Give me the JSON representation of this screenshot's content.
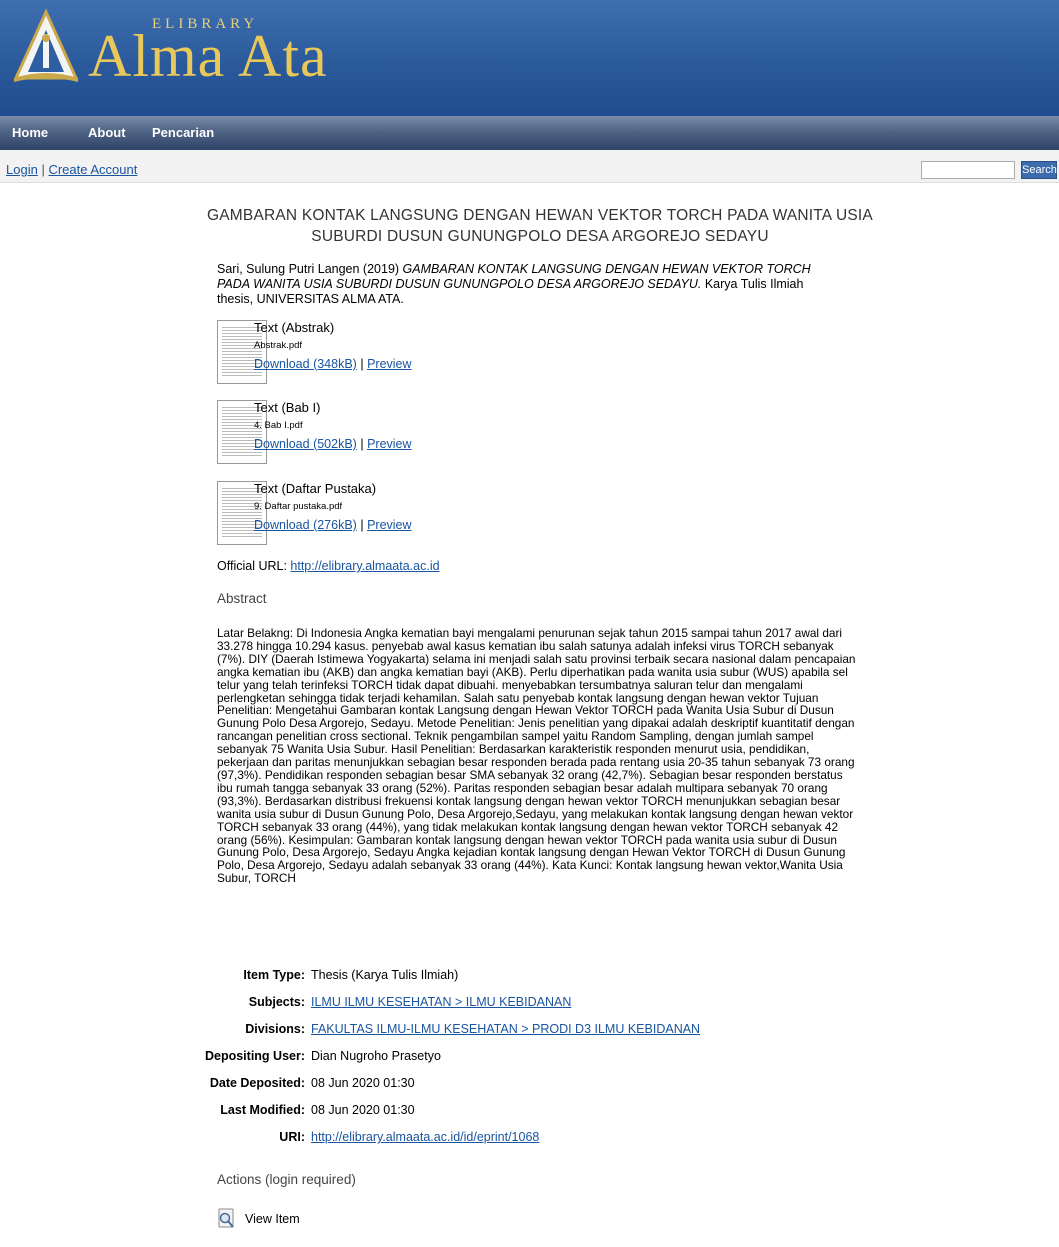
{
  "header": {
    "logo_small": "ELIBRARY",
    "logo_main": "Alma Ata"
  },
  "nav": [
    "Home",
    "About",
    "Pencarian"
  ],
  "account": {
    "login": "Login",
    "separator": "|",
    "create": "Create Account"
  },
  "search": {
    "button": "Search",
    "value": ""
  },
  "title": "GAMBARAN KONTAK LANGSUNG DENGAN HEWAN VEKTOR TORCH PADA WANITA USIA SUBURDI DUSUN GUNUNGPOLO DESA ARGOREJO SEDAYU",
  "citation": {
    "author_year": "Sari, Sulung Putri Langen (2019) ",
    "title_italic": "GAMBARAN KONTAK LANGSUNG DENGAN HEWAN VEKTOR TORCH PADA WANITA USIA SUBURDI DUSUN GUNUNGPOLO DESA ARGOREJO SEDAYU.",
    "rest": " Karya Tulis Ilmiah thesis, UNIVERSITAS ALMA ATA."
  },
  "documents": [
    {
      "type": "Text (Abstrak)",
      "file": "Abstrak.pdf",
      "download": "Download (348kB)",
      "sep": "|",
      "preview": "Preview"
    },
    {
      "type": "Text (Bab I)",
      "file": "4. Bab I.pdf",
      "download": "Download (502kB)",
      "sep": "|",
      "preview": "Preview"
    },
    {
      "type": "Text (Daftar Pustaka)",
      "file": "9. Daftar pustaka.pdf",
      "download": "Download (276kB)",
      "sep": "|",
      "preview": "Preview"
    }
  ],
  "official": {
    "label": "Official URL: ",
    "url": "http://elibrary.almaata.ac.id"
  },
  "abstract_heading": "Abstract",
  "abstract": "Latar Belakng: Di Indonesia Angka kematian bayi mengalami penurunan sejak tahun 2015 sampai tahun 2017 awal dari 33.278 hingga 10.294 kasus. penyebab awal kasus kematian ibu salah satunya adalah infeksi virus TORCH sebanyak (7%). DIY (Daerah Istimewa Yogyakarta) selama ini menjadi salah satu provinsi terbaik secara nasional dalam pencapaian angka kematian ibu (AKB) dan angka kematian bayi (AKB). Perlu diperhatikan pada wanita usia subur (WUS) apabila sel telur yang telah terinfeksi TORCH tidak dapat dibuahi. menyebabkan tersumbatnya saluran telur dan mengalami perlengketan sehingga tidak terjadi kehamilan. Salah satu penyebab kontak langsung dengan hewan vektor  Tujuan Penelitian: Mengetahui Gambaran kontak Langsung dengan Hewan Vektor TORCH pada Wanita Usia Subur di Dusun Gunung Polo Desa Argorejo, Sedayu.  Metode Penelitian: Jenis penelitian yang dipakai adalah deskriptif kuantitatif dengan rancangan penelitian cross sectional. Teknik pengambilan sampel yaitu Random Sampling, dengan jumlah sampel sebanyak 75 Wanita Usia Subur.  Hasil Penelitian: Berdasarkan karakteristik responden menurut usia, pendidikan, pekerjaan dan paritas menunjukkan sebagian besar responden berada pada rentang usia 20-35 tahun sebanyak 73 orang (97,3%). Pendidikan responden sebagian besar SMA sebanyak 32 orang (42,7%). Sebagian besar responden berstatus ibu rumah tangga sebanyak 33 orang (52%). Paritas responden sebagian besar adalah multipara sebanyak 70 orang (93,3%). Berdasarkan distribusi frekuensi kontak langsung dengan hewan vektor TORCH menunjukkan sebagian besar wanita usia subur di Dusun Gunung Polo, Desa Argorejo,Sedayu, yang melakukan kontak langsung dengan hewan vektor TORCH sebanyak 33 orang (44%), yang tidak melakukan kontak langsung dengan hewan vektor TORCH sebanyak 42 orang (56%).   Kesimpulan: Gambaran kontak langsung dengan hewan vektor TORCH pada wanita usia subur di Dusun Gunung Polo, Desa Argorejo, Sedayu Angka kejadian kontak langsung dengan Hewan Vektor TORCH di Dusun Gunung Polo, Desa Argorejo, Sedayu adalah sebanyak 33 orang (44%).  Kata Kunci: Kontak langsung hewan vektor,Wanita Usia Subur, TORCH",
  "metadata": [
    {
      "label": "Item Type:",
      "value": "Thesis (Karya Tulis Ilmiah)",
      "link": false
    },
    {
      "label": "Subjects:",
      "value": "ILMU ILMU KESEHATAN > ILMU KEBIDANAN",
      "link": true
    },
    {
      "label": "Divisions:",
      "value": "FAKULTAS ILMU-ILMU KESEHATAN > PRODI D3 ILMU KEBIDANAN",
      "link": true
    },
    {
      "label": "Depositing User:",
      "value": "Dian Nugroho Prasetyo",
      "link": false
    },
    {
      "label": "Date Deposited:",
      "value": "08 Jun 2020 01:30",
      "link": false
    },
    {
      "label": "Last Modified:",
      "value": "08 Jun 2020 01:30",
      "link": false
    },
    {
      "label": "URI:",
      "value": "http://elibrary.almaata.ac.id/id/eprint/1068",
      "link": true
    }
  ],
  "actions_heading": "Actions (login required)",
  "view_item": "View Item"
}
